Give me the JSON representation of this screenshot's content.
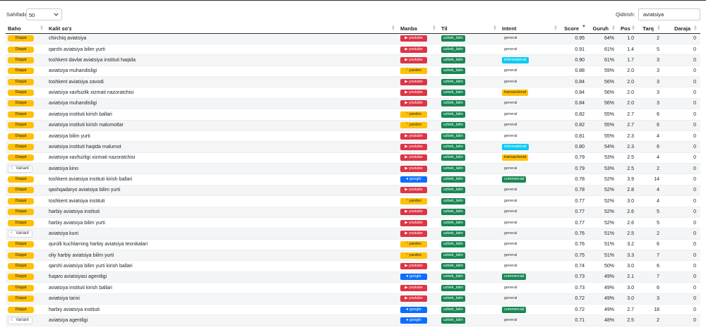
{
  "controls": {
    "length_label": "Sahifada",
    "length_value": "50",
    "search_label": "Qidirish:",
    "search_value": "aviatsiya"
  },
  "columns": [
    "Baho",
    "Kalit so'z",
    "Manba",
    "Til",
    "Intent",
    "Score",
    "Guruh",
    "Pos",
    "Tarq",
    "Daraja"
  ],
  "sorted_column": "Score",
  "rows": [
    {
      "baho": "Diqqat",
      "keyword": "chirchiq aviatsiya",
      "source": "youtube",
      "lang": "uzbek_latin",
      "intent": "general",
      "score": "0.95",
      "guruh": "64%",
      "pos": "1.0",
      "tarq": "2",
      "daraja": "0"
    },
    {
      "baho": "Diqqat",
      "keyword": "qarshi aviatsiya bilim yurti",
      "source": "youtube",
      "lang": "uzbek_latin",
      "intent": "general",
      "score": "0.91",
      "guruh": "61%",
      "pos": "1.4",
      "tarq": "5",
      "daraja": "0"
    },
    {
      "baho": "Diqqat",
      "keyword": "toshkent davlat aviatsiya instituti haqida",
      "source": "youtube",
      "lang": "uzbek_latin",
      "intent": "informational",
      "score": "0.90",
      "guruh": "61%",
      "pos": "1.7",
      "tarq": "3",
      "daraja": "0"
    },
    {
      "baho": "Diqqat",
      "keyword": "aviatsiya muhandisligi",
      "source": "yandex",
      "lang": "uzbek_latin",
      "intent": "general",
      "score": "0.88",
      "guruh": "59%",
      "pos": "2.0",
      "tarq": "3",
      "daraja": "0"
    },
    {
      "baho": "Diqqat",
      "keyword": "toshkent aviatsiya zavodi",
      "source": "youtube",
      "lang": "uzbek_latin",
      "intent": "general",
      "score": "0.84",
      "guruh": "56%",
      "pos": "2.0",
      "tarq": "3",
      "daraja": "0"
    },
    {
      "baho": "Diqqat",
      "keyword": "aviatsiya xavfsizlik xizmati nazoratchisi",
      "source": "youtube",
      "lang": "uzbek_latin",
      "intent": "transactional",
      "score": "0.84",
      "guruh": "56%",
      "pos": "2.0",
      "tarq": "3",
      "daraja": "0"
    },
    {
      "baho": "Diqqat",
      "keyword": "aviatsiya muhandisligi",
      "source": "youtube",
      "lang": "uzbek_latin",
      "intent": "general",
      "score": "0.84",
      "guruh": "56%",
      "pos": "2.0",
      "tarq": "3",
      "daraja": "0"
    },
    {
      "baho": "Diqqat",
      "keyword": "aviatsiya instituti kirish ballari",
      "source": "yandex",
      "lang": "uzbek_latin",
      "intent": "general",
      "score": "0.82",
      "guruh": "55%",
      "pos": "2.7",
      "tarq": "6",
      "daraja": "0"
    },
    {
      "baho": "Diqqat",
      "keyword": "aviatsiya instituti kirish malumotlar",
      "source": "yandex",
      "lang": "uzbek_latin",
      "intent": "general",
      "score": "0.82",
      "guruh": "55%",
      "pos": "2.7",
      "tarq": "6",
      "daraja": "0"
    },
    {
      "baho": "Diqqat",
      "keyword": "aviatsiya bilim yurti",
      "source": "youtube",
      "lang": "uzbek_latin",
      "intent": "general",
      "score": "0.81",
      "guruh": "55%",
      "pos": "2.3",
      "tarq": "4",
      "daraja": "0"
    },
    {
      "baho": "Diqqat",
      "keyword": "aviatsiya instituti haqida malumot",
      "source": "youtube",
      "lang": "uzbek_latin",
      "intent": "informational",
      "score": "0.80",
      "guruh": "54%",
      "pos": "2.3",
      "tarq": "6",
      "daraja": "0"
    },
    {
      "baho": "Diqqat",
      "keyword": "aviatsiya xavfsizligi xizmati nazoratchisi",
      "source": "youtube",
      "lang": "uzbek_latin",
      "intent": "transactional",
      "score": "0.79",
      "guruh": "53%",
      "pos": "2.5",
      "tarq": "4",
      "daraja": "0"
    },
    {
      "baho": "Variant",
      "keyword": "aviatsiya kino",
      "source": "youtube",
      "lang": "uzbek_latin",
      "intent": "general",
      "score": "0.79",
      "guruh": "53%",
      "pos": "2.5",
      "tarq": "2",
      "daraja": "0"
    },
    {
      "baho": "Diqqat",
      "keyword": "toshkent aviatsiya instituti kirish ballari",
      "source": "google",
      "lang": "uzbek_latin",
      "intent": "commercial",
      "score": "0.78",
      "guruh": "52%",
      "pos": "3.9",
      "tarq": "14",
      "daraja": "0"
    },
    {
      "baho": "Diqqat",
      "keyword": "qashqadaryo aviatsiya bilim yurti",
      "source": "youtube",
      "lang": "uzbek_latin",
      "intent": "general",
      "score": "0.78",
      "guruh": "52%",
      "pos": "2.8",
      "tarq": "4",
      "daraja": "0"
    },
    {
      "baho": "Diqqat",
      "keyword": "toshkent aviatsiya instituti",
      "source": "yandex",
      "lang": "uzbek_latin",
      "intent": "general",
      "score": "0.77",
      "guruh": "52%",
      "pos": "3.0",
      "tarq": "4",
      "daraja": "0"
    },
    {
      "baho": "Diqqat",
      "keyword": "harbiy aviatsiya instituti",
      "source": "youtube",
      "lang": "uzbek_latin",
      "intent": "general",
      "score": "0.77",
      "guruh": "52%",
      "pos": "2.6",
      "tarq": "5",
      "daraja": "0"
    },
    {
      "baho": "Diqqat",
      "keyword": "harbiy aviatsiya bilim yurti",
      "source": "youtube",
      "lang": "uzbek_latin",
      "intent": "general",
      "score": "0.77",
      "guruh": "52%",
      "pos": "2.6",
      "tarq": "5",
      "daraja": "0"
    },
    {
      "baho": "Variant",
      "keyword": "aviatsiya kuni",
      "source": "youtube",
      "lang": "uzbek_latin",
      "intent": "general",
      "score": "0.76",
      "guruh": "51%",
      "pos": "2.5",
      "tarq": "2",
      "daraja": "0"
    },
    {
      "baho": "Diqqat",
      "keyword": "qurolli kuchlarning harbiy aviatsiya texnikalari",
      "source": "yandex",
      "lang": "uzbek_latin",
      "intent": "general",
      "score": "0.76",
      "guruh": "51%",
      "pos": "3.2",
      "tarq": "6",
      "daraja": "0"
    },
    {
      "baho": "Diqqat",
      "keyword": "oliy harbiy aviatsiya bilim yurti",
      "source": "yandex",
      "lang": "uzbek_latin",
      "intent": "general",
      "score": "0.75",
      "guruh": "51%",
      "pos": "3.3",
      "tarq": "7",
      "daraja": "0"
    },
    {
      "baho": "Diqqat",
      "keyword": "qarshi aviatsiya bilim yurti kirish ballari",
      "source": "youtube",
      "lang": "uzbek_latin",
      "intent": "general",
      "score": "0.74",
      "guruh": "50%",
      "pos": "3.0",
      "tarq": "6",
      "daraja": "0"
    },
    {
      "baho": "Diqqat",
      "keyword": "fuqaro aviatsiyasi agentligi",
      "source": "google",
      "lang": "uzbek_latin",
      "intent": "commercial",
      "score": "0.73",
      "guruh": "49%",
      "pos": "2.1",
      "tarq": "7",
      "daraja": "0"
    },
    {
      "baho": "Diqqat",
      "keyword": "aviatsiya instituti kirish ballari",
      "source": "youtube",
      "lang": "uzbek_latin",
      "intent": "general",
      "score": "0.73",
      "guruh": "49%",
      "pos": "3.0",
      "tarq": "6",
      "daraja": "0"
    },
    {
      "baho": "Diqqat",
      "keyword": "aviatsiya tarixi",
      "source": "youtube",
      "lang": "uzbek_latin",
      "intent": "general",
      "score": "0.72",
      "guruh": "49%",
      "pos": "3.0",
      "tarq": "3",
      "daraja": "0"
    },
    {
      "baho": "Diqqat",
      "keyword": "harbiy aviatsiya instituti",
      "source": "google",
      "lang": "uzbek_latin",
      "intent": "commercial",
      "score": "0.72",
      "guruh": "49%",
      "pos": "2.7",
      "tarq": "18",
      "daraja": "0"
    },
    {
      "baho": "Variant",
      "keyword": "aviatsiya agentligi",
      "source": "google",
      "lang": "uzbek_latin",
      "intent": "general",
      "score": "0.71",
      "guruh": "48%",
      "pos": "2.5",
      "tarq": "2",
      "daraja": "0"
    }
  ],
  "colors": {
    "youtube": "#dc3545",
    "yandex": "#ffc107",
    "google": "#0d6efd",
    "lang": "#198754",
    "diqqat": "#ffc107",
    "informational": "#0dcaf0",
    "transactional": "#ffc107",
    "commercial": "#198754"
  },
  "icons": {
    "youtube": "play-icon",
    "yandex": "yandex-icon",
    "google": "google-icon",
    "variant": "moon-icon",
    "length_select": "chevron-down-icon"
  }
}
